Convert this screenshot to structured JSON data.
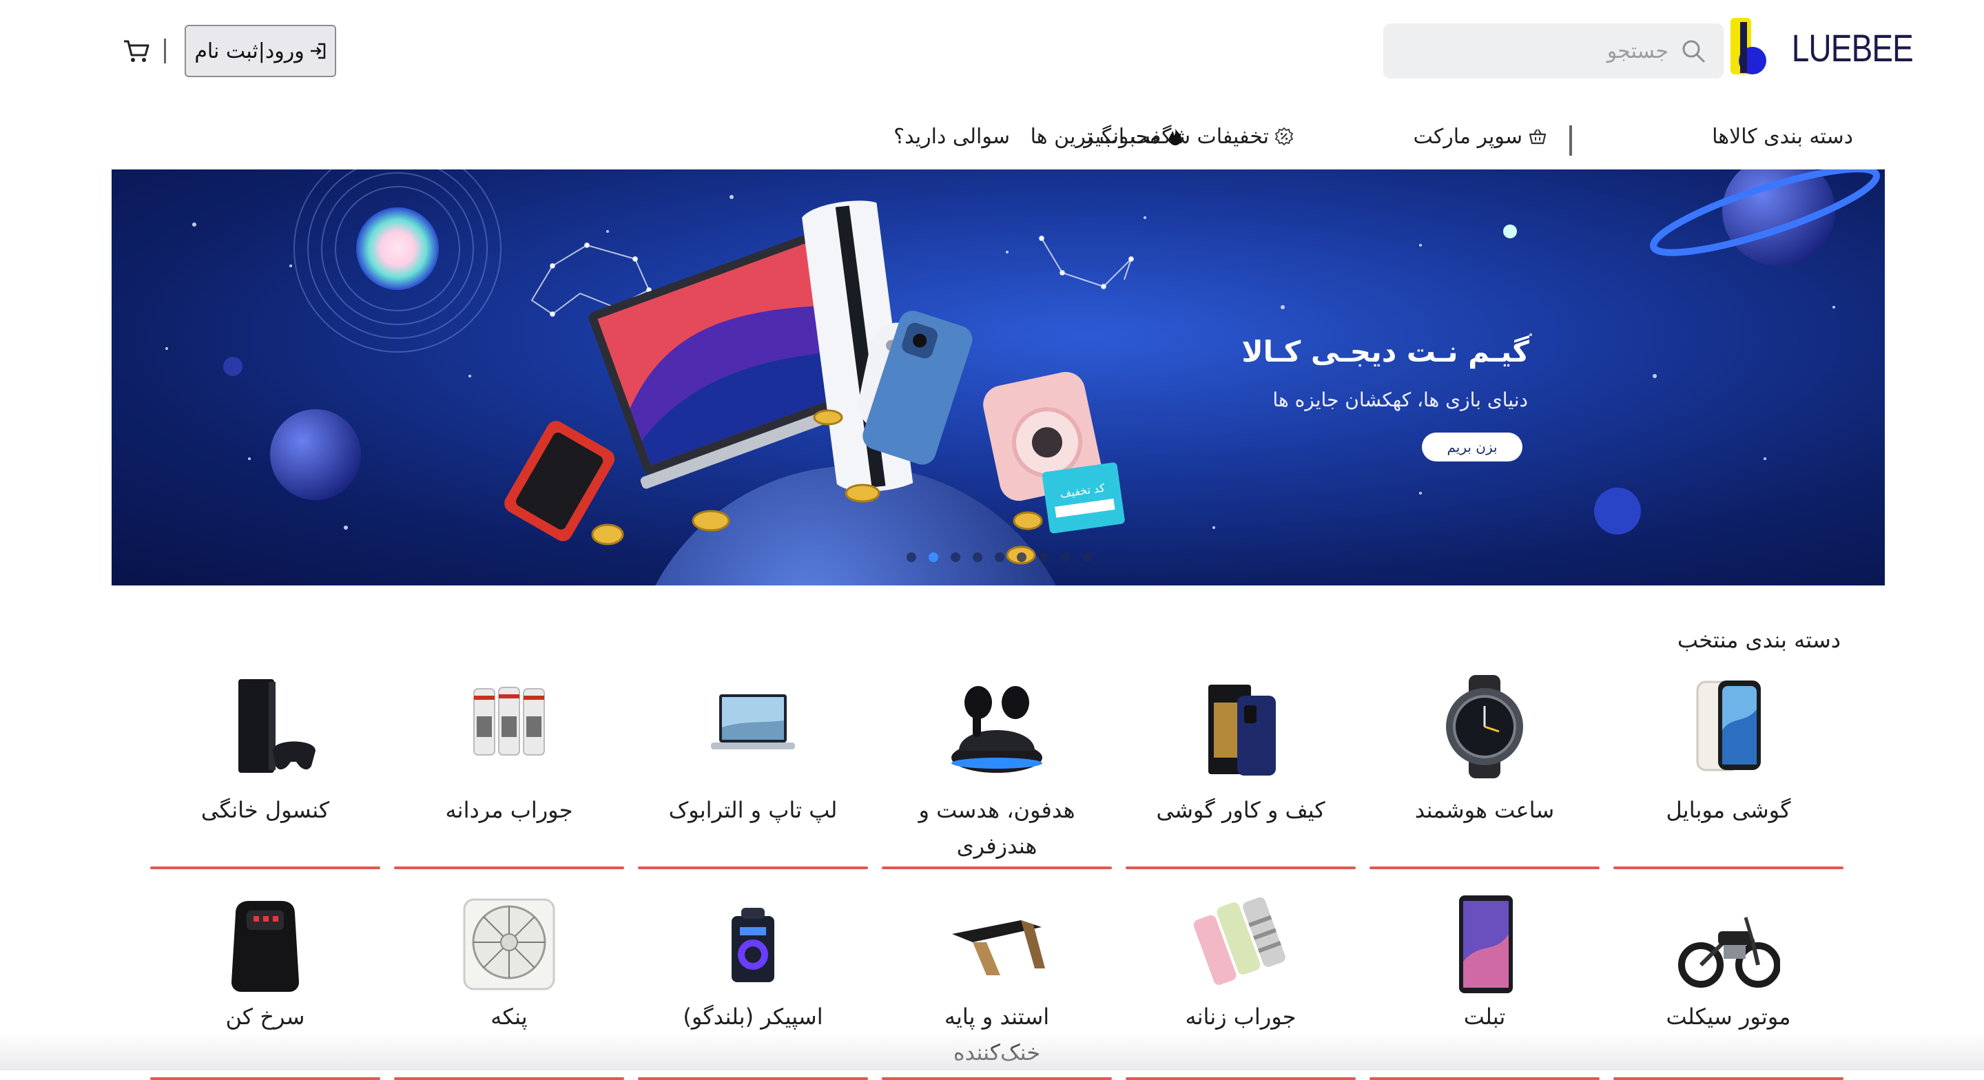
{
  "header": {
    "logo_text": "LUEBEE",
    "search_placeholder": "جستجو",
    "login_label": "ورود|ثبت نام"
  },
  "nav": {
    "categories": "دسته بندی کالاها",
    "supermarket": "سوپر مارکت",
    "offers": "تخفیفات شگفت انگیز",
    "popular": "محبوب ترین ها",
    "question": "سوالی دارید؟"
  },
  "banner": {
    "title": "گیـم نـت دیجـی کـالا",
    "subtitle": "دنیای بازی ها، کهکشان جایزه ها",
    "button": "بزن بریم",
    "coupon": "کد تخفیف",
    "dots_count": 9,
    "active_dot": 1
  },
  "categories": {
    "title": "دسته بندی منتخب",
    "row1": [
      {
        "label": "گوشی موبایل",
        "icon": "mobile-phone-icon"
      },
      {
        "label": "ساعت هوشمند",
        "icon": "smartwatch-icon"
      },
      {
        "label": "کیف و کاور گوشی",
        "icon": "phone-case-icon"
      },
      {
        "label": "هدفون، هدست و هندزفری",
        "icon": "earbuds-icon"
      },
      {
        "label": "لپ تاپ و الترابوک",
        "icon": "laptop-icon"
      },
      {
        "label": "جوراب مردانه",
        "icon": "mens-socks-icon"
      },
      {
        "label": "کنسول خانگی",
        "icon": "game-console-icon"
      }
    ],
    "row2": [
      {
        "label": "موتور سیکلت",
        "icon": "motorcycle-icon"
      },
      {
        "label": "تبلت",
        "icon": "tablet-icon"
      },
      {
        "label": "جوراب زنانه",
        "icon": "womens-socks-icon"
      },
      {
        "label": "استند و پایه خنک‌کننده",
        "icon": "laptop-stand-icon"
      },
      {
        "label": "اسپیکر (بلندگو)",
        "icon": "speaker-icon"
      },
      {
        "label": "پنکه",
        "icon": "fan-icon"
      },
      {
        "label": "سرخ کن",
        "icon": "air-fryer-icon"
      }
    ]
  },
  "colors": {
    "accent_line": "#e05a4f",
    "search_bg": "#eeeff1",
    "logo_yellow": "#f5e500",
    "logo_blue": "#1f22d6"
  }
}
